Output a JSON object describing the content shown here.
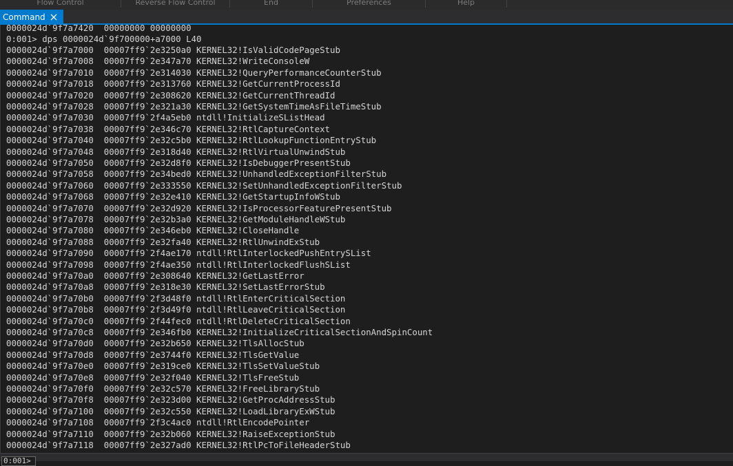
{
  "ribbon": {
    "groups": [
      "Flow Control",
      "Reverse Flow Control",
      "End",
      "Preferences",
      "Help"
    ]
  },
  "tab": {
    "label": "Command"
  },
  "output": {
    "partial_first_line": "0000024d`9f7a7420  00000000 00000000",
    "command": "0:001> dps 0000024d`9f700000+a7000 L40",
    "rows": [
      {
        "addr": "0000024d`9f7a7000",
        "value": "00007ff9`2e3250a0",
        "symbol": "KERNEL32!IsValidCodePageStub"
      },
      {
        "addr": "0000024d`9f7a7008",
        "value": "00007ff9`2e347a70",
        "symbol": "KERNEL32!WriteConsoleW"
      },
      {
        "addr": "0000024d`9f7a7010",
        "value": "00007ff9`2e314030",
        "symbol": "KERNEL32!QueryPerformanceCounterStub"
      },
      {
        "addr": "0000024d`9f7a7018",
        "value": "00007ff9`2e313760",
        "symbol": "KERNEL32!GetCurrentProcessId"
      },
      {
        "addr": "0000024d`9f7a7020",
        "value": "00007ff9`2e308620",
        "symbol": "KERNEL32!GetCurrentThreadId"
      },
      {
        "addr": "0000024d`9f7a7028",
        "value": "00007ff9`2e321a30",
        "symbol": "KERNEL32!GetSystemTimeAsFileTimeStub"
      },
      {
        "addr": "0000024d`9f7a7030",
        "value": "00007ff9`2f4a5eb0",
        "symbol": "ntdll!InitializeSListHead"
      },
      {
        "addr": "0000024d`9f7a7038",
        "value": "00007ff9`2e346c70",
        "symbol": "KERNEL32!RtlCaptureContext"
      },
      {
        "addr": "0000024d`9f7a7040",
        "value": "00007ff9`2e32c5b0",
        "symbol": "KERNEL32!RtlLookupFunctionEntryStub"
      },
      {
        "addr": "0000024d`9f7a7048",
        "value": "00007ff9`2e318d40",
        "symbol": "KERNEL32!RtlVirtualUnwindStub"
      },
      {
        "addr": "0000024d`9f7a7050",
        "value": "00007ff9`2e32d8f0",
        "symbol": "KERNEL32!IsDebuggerPresentStub"
      },
      {
        "addr": "0000024d`9f7a7058",
        "value": "00007ff9`2e34bed0",
        "symbol": "KERNEL32!UnhandledExceptionFilterStub"
      },
      {
        "addr": "0000024d`9f7a7060",
        "value": "00007ff9`2e333550",
        "symbol": "KERNEL32!SetUnhandledExceptionFilterStub"
      },
      {
        "addr": "0000024d`9f7a7068",
        "value": "00007ff9`2e32e410",
        "symbol": "KERNEL32!GetStartupInfoWStub"
      },
      {
        "addr": "0000024d`9f7a7070",
        "value": "00007ff9`2e32d920",
        "symbol": "KERNEL32!IsProcessorFeaturePresentStub"
      },
      {
        "addr": "0000024d`9f7a7078",
        "value": "00007ff9`2e32b3a0",
        "symbol": "KERNEL32!GetModuleHandleWStub"
      },
      {
        "addr": "0000024d`9f7a7080",
        "value": "00007ff9`2e346eb0",
        "symbol": "KERNEL32!CloseHandle"
      },
      {
        "addr": "0000024d`9f7a7088",
        "value": "00007ff9`2e32fa40",
        "symbol": "KERNEL32!RtlUnwindExStub"
      },
      {
        "addr": "0000024d`9f7a7090",
        "value": "00007ff9`2f4ae170",
        "symbol": "ntdll!RtlInterlockedPushEntrySList"
      },
      {
        "addr": "0000024d`9f7a7098",
        "value": "00007ff9`2f4ae350",
        "symbol": "ntdll!RtlInterlockedFlushSList"
      },
      {
        "addr": "0000024d`9f7a70a0",
        "value": "00007ff9`2e308640",
        "symbol": "KERNEL32!GetLastError"
      },
      {
        "addr": "0000024d`9f7a70a8",
        "value": "00007ff9`2e318e30",
        "symbol": "KERNEL32!SetLastErrorStub"
      },
      {
        "addr": "0000024d`9f7a70b0",
        "value": "00007ff9`2f3d48f0",
        "symbol": "ntdll!RtlEnterCriticalSection"
      },
      {
        "addr": "0000024d`9f7a70b8",
        "value": "00007ff9`2f3d49f0",
        "symbol": "ntdll!RtlLeaveCriticalSection"
      },
      {
        "addr": "0000024d`9f7a70c0",
        "value": "00007ff9`2f44fec0",
        "symbol": "ntdll!RtlDeleteCriticalSection"
      },
      {
        "addr": "0000024d`9f7a70c8",
        "value": "00007ff9`2e346fb0",
        "symbol": "KERNEL32!InitializeCriticalSectionAndSpinCount"
      },
      {
        "addr": "0000024d`9f7a70d0",
        "value": "00007ff9`2e32b650",
        "symbol": "KERNEL32!TlsAllocStub"
      },
      {
        "addr": "0000024d`9f7a70d8",
        "value": "00007ff9`2e3744f0",
        "symbol": "KERNEL32!TlsGetValue"
      },
      {
        "addr": "0000024d`9f7a70e0",
        "value": "00007ff9`2e319ce0",
        "symbol": "KERNEL32!TlsSetValueStub"
      },
      {
        "addr": "0000024d`9f7a70e8",
        "value": "00007ff9`2e32f040",
        "symbol": "KERNEL32!TlsFreeStub"
      },
      {
        "addr": "0000024d`9f7a70f0",
        "value": "00007ff9`2e32c570",
        "symbol": "KERNEL32!FreeLibraryStub"
      },
      {
        "addr": "0000024d`9f7a70f8",
        "value": "00007ff9`2e323d00",
        "symbol": "KERNEL32!GetProcAddressStub"
      },
      {
        "addr": "0000024d`9f7a7100",
        "value": "00007ff9`2e32c550",
        "symbol": "KERNEL32!LoadLibraryExWStub"
      },
      {
        "addr": "0000024d`9f7a7108",
        "value": "00007ff9`2f3c4ac0",
        "symbol": "ntdll!RtlEncodePointer"
      },
      {
        "addr": "0000024d`9f7a7110",
        "value": "00007ff9`2e32b060",
        "symbol": "KERNEL32!RaiseExceptionStub"
      },
      {
        "addr": "0000024d`9f7a7118",
        "value": "00007ff9`2e327ad0",
        "symbol": "KERNEL32!RtlPcToFileHeaderStub"
      }
    ]
  },
  "input": {
    "prompt": "0:001>"
  },
  "colors": {
    "accent": "#007acc",
    "background": "#1e1e1e",
    "text": "#d4d4d4"
  }
}
